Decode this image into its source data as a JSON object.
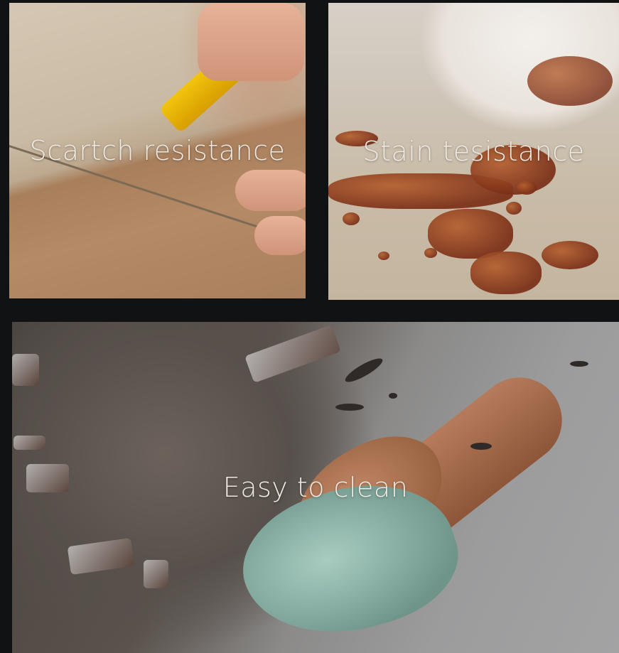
{
  "features": [
    {
      "caption": "Scartch resistance"
    },
    {
      "caption": "Stain tesistance"
    },
    {
      "caption": "Easy to clean"
    }
  ]
}
